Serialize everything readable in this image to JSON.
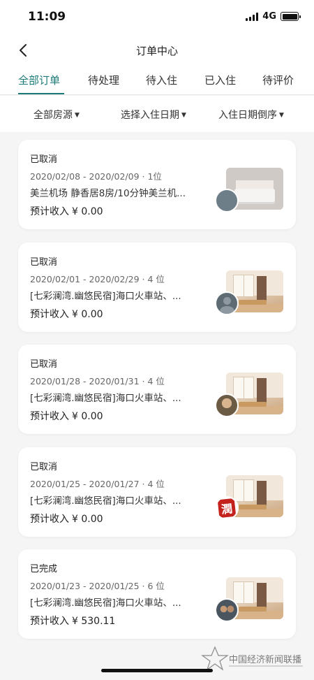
{
  "status_bar": {
    "time": "11:09",
    "network": "4G"
  },
  "nav": {
    "title": "订单中心"
  },
  "tabs": [
    {
      "label": "全部订单",
      "active": true
    },
    {
      "label": "待处理",
      "active": false
    },
    {
      "label": "待入住",
      "active": false
    },
    {
      "label": "已入住",
      "active": false
    },
    {
      "label": "待评价",
      "active": false
    }
  ],
  "filters": [
    {
      "label": "全部房源"
    },
    {
      "label": "选择入住日期"
    },
    {
      "label": "入住日期倒序"
    }
  ],
  "orders": [
    {
      "status": "已取消",
      "dates": "2020/02/08 - 2020/02/09 · 1位",
      "name": "美兰机场 静香居8房/10分钟美兰机...",
      "income_label": "预计收入",
      "income_amount": "¥ 0.00",
      "thumb_icon": "bedroom-photo-icon",
      "avatar_icon": "host-avatar-icon"
    },
    {
      "status": "已取消",
      "dates": "2020/02/01 - 2020/02/29 · 4 位",
      "name": "[七彩澜湾.幽悠民宿]海口火車站、...",
      "income_label": "预计收入",
      "income_amount": "¥ 0.00",
      "thumb_icon": "room-photo-icon",
      "avatar_icon": "default-user-avatar-icon"
    },
    {
      "status": "已取消",
      "dates": "2020/01/28 - 2020/01/31 · 4 位",
      "name": "[七彩澜湾.幽悠民宿]海口火車站、...",
      "income_label": "预计收入",
      "income_amount": "¥ 0.00",
      "thumb_icon": "room-photo-icon",
      "avatar_icon": "guest-photo-avatar-icon"
    },
    {
      "status": "已取消",
      "dates": "2020/01/25 - 2020/01/27 · 4 位",
      "name": "[七彩澜湾.幽悠民宿]海口火車站、...",
      "income_label": "预计收入",
      "income_amount": "¥ 0.00",
      "thumb_icon": "room-photo-icon",
      "avatar_icon": "seal-avatar-icon",
      "avatar_text": "潤"
    },
    {
      "status": "已完成",
      "dates": "2020/01/23 - 2020/01/25 · 6 位",
      "name": "[七彩澜湾.幽悠民宿]海口火車站、...",
      "income_label": "预计收入",
      "income_amount": "¥ 530.11",
      "thumb_icon": "room-photo-icon",
      "avatar_icon": "group-photo-avatar-icon"
    }
  ],
  "watermark": {
    "text": "中国经济新闻联播"
  }
}
